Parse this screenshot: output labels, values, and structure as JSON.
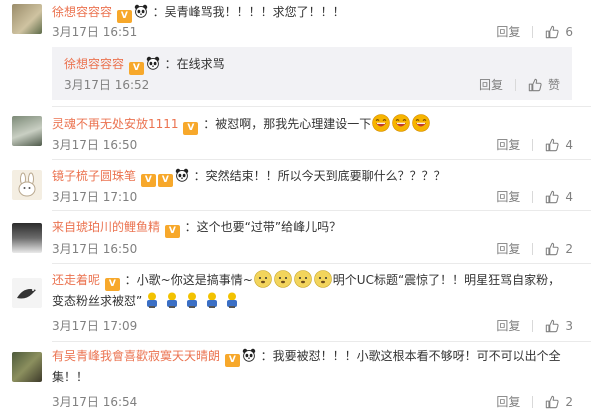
{
  "comments": [
    {
      "user": "徐想容容容",
      "text": "：吴青峰骂我！！！！求您了！！！",
      "time": "3月17日 16:51",
      "reply": "回复",
      "likes": "6"
    },
    {
      "user": "灵魂不再无处安放1111",
      "text": "：被怼啊，那我先心理建设一下",
      "time": "3月17日 16:50",
      "reply": "回复",
      "likes": "4"
    },
    {
      "user": "镜子梳子圆珠笔",
      "text": "：突然结束！！所以今天到底要聊什么？？？？",
      "time": "3月17日 17:10",
      "reply": "回复",
      "likes": "4"
    },
    {
      "user": "来自琥珀川的鲤鱼精",
      "text": "：这个也要“过带”给峰儿吗？",
      "time": "3月17日 16:50",
      "reply": "回复",
      "likes": "2"
    },
    {
      "user": "还走着呢",
      "text_a": "：小歌~你这是搞事情~",
      "text_b": "明个UC标题“震惊了！！明星狂骂自家粉，变态粉丝求被怼”",
      "time": "3月17日 17:09",
      "reply": "回复",
      "likes": "3"
    },
    {
      "user": "有吴青峰我會喜歡寂寞天天晴朗",
      "text": "：我要被怼！！！小歌这根本看不够呀！可不可以出个全集！！",
      "time": "3月17日 16:54",
      "reply": "回复",
      "likes": "2"
    }
  ],
  "sub_reply": {
    "user": "徐想容容容",
    "text": "：在线求骂",
    "time": "3月17日 16:52",
    "reply": "回复",
    "like_label": "赞"
  },
  "colors": {
    "username": "#eb7350",
    "meta": "#808080",
    "subbox_bg": "#f2f2f5",
    "vip_badge": "#f7a82b"
  }
}
